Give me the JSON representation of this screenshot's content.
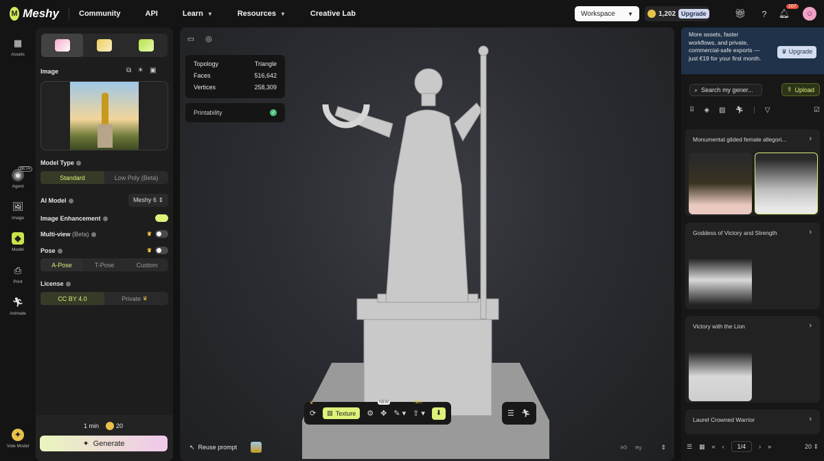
{
  "brand": {
    "name": "Meshy"
  },
  "nav": {
    "items": [
      "Community",
      "API",
      "Learn",
      "Resources",
      "Creative Lab"
    ]
  },
  "workspace": {
    "label": "Workspace"
  },
  "credits": {
    "amount": "1,202",
    "upgrade": "Upgrade"
  },
  "notifications": {
    "count": "107"
  },
  "sidebar": {
    "items": [
      {
        "label": "Assets",
        "icon": "grid-icon"
      },
      {
        "label": "Agent",
        "icon": "agent-icon",
        "badge": "BETA"
      },
      {
        "label": "Image",
        "icon": "image-icon"
      },
      {
        "label": "Model",
        "icon": "cube-icon"
      },
      {
        "label": "Print",
        "icon": "print-icon"
      },
      {
        "label": "Animate",
        "icon": "run-icon"
      }
    ],
    "vote_label": "Vote Model"
  },
  "left_panel": {
    "image_label": "Image",
    "model_type": {
      "label": "Model Type",
      "options": [
        "Standard",
        "Low Poly (Beta)"
      ],
      "selected": "Standard"
    },
    "ai_model": {
      "label": "AI Model",
      "value": "Meshy 6"
    },
    "image_enhancement": {
      "label": "Image Enhancement",
      "on": true
    },
    "multiview": {
      "label": "Multi-view",
      "suffix": "(Beta)",
      "on": false
    },
    "pose": {
      "label": "Pose",
      "options": [
        "A-Pose",
        "T-Pose",
        "Custom"
      ],
      "selected": "A-Pose",
      "on": false
    },
    "license": {
      "label": "License",
      "options": [
        "CC BY 4.0",
        "Private"
      ],
      "selected": "CC BY 4.0"
    },
    "time": "1 min",
    "cost": "20",
    "generate": "Generate"
  },
  "viewport": {
    "stats": [
      {
        "label": "Topology",
        "value": "Triangle"
      },
      {
        "label": "Faces",
        "value": "516,642"
      },
      {
        "label": "Vertices",
        "value": "258,309"
      }
    ],
    "printability": "Printability",
    "toolbar": {
      "texture": "Texture",
      "new_tag": "NEW",
      "price_tag": "+$20"
    },
    "reuse_prompt": "Reuse prompt"
  },
  "right_panel": {
    "banner": "More assets, faster workflows, and private, commercial-safe exports — just €19 for your first month.",
    "banner_button": "Upgrade",
    "search_placeholder": "Search my gener...",
    "upload": "Upload",
    "cards": [
      {
        "title": "Monumental gilded female allegori..."
      },
      {
        "title": "Goddess of Victory and Strength"
      },
      {
        "title": "Victory with the Lion"
      },
      {
        "title": "Laurel Crowned Warrior"
      }
    ],
    "page": "1/4",
    "page_size": "20"
  }
}
